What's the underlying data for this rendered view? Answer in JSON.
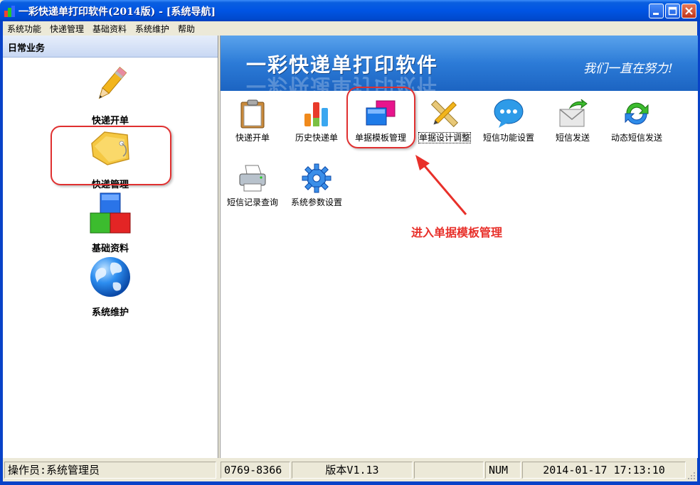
{
  "window": {
    "title": "一彩快递单打印软件(2014版) - [系统导航]"
  },
  "menu": [
    "系统功能",
    "快递管理",
    "基础资料",
    "系统维护",
    "帮助"
  ],
  "sidebar": {
    "header": "日常业务",
    "items": [
      {
        "label": "快递开单",
        "icon": "pencil-icon"
      },
      {
        "label": "快递管理",
        "icon": "tag-folder-icon"
      },
      {
        "label": "基础资料",
        "icon": "blocks-icon"
      },
      {
        "label": "系统维护",
        "icon": "globe-icon"
      }
    ]
  },
  "banner": {
    "title": "一彩快递单打印软件",
    "slogan": "我们一直在努力!"
  },
  "tools": [
    {
      "label": "快递开单",
      "icon": "clipboard-icon"
    },
    {
      "label": "历史快递单",
      "icon": "bar-chart-icon"
    },
    {
      "label": "单据模板管理",
      "icon": "windows-icon"
    },
    {
      "label": "单据设计调整",
      "icon": "design-tools-icon"
    },
    {
      "label": "短信功能设置",
      "icon": "speech-bubble-icon"
    },
    {
      "label": "短信发送",
      "icon": "mail-send-icon"
    },
    {
      "label": "动态短信发送",
      "icon": "refresh-icon"
    },
    {
      "label": "短信记录查询",
      "icon": "printer-icon"
    },
    {
      "label": "系统参数设置",
      "icon": "gear-icon"
    }
  ],
  "annotation": "进入单据模板管理",
  "status": {
    "operator": "操作员:系统管理员",
    "phone": "0769-8366",
    "version": "版本V1.13",
    "empty": "",
    "numlock": "NUM",
    "datetime": "2014-01-17  17:13:10"
  },
  "colors": {
    "accent": "#e8302a",
    "titlebar": "#0054e3",
    "banner": "#2c7bd7"
  }
}
